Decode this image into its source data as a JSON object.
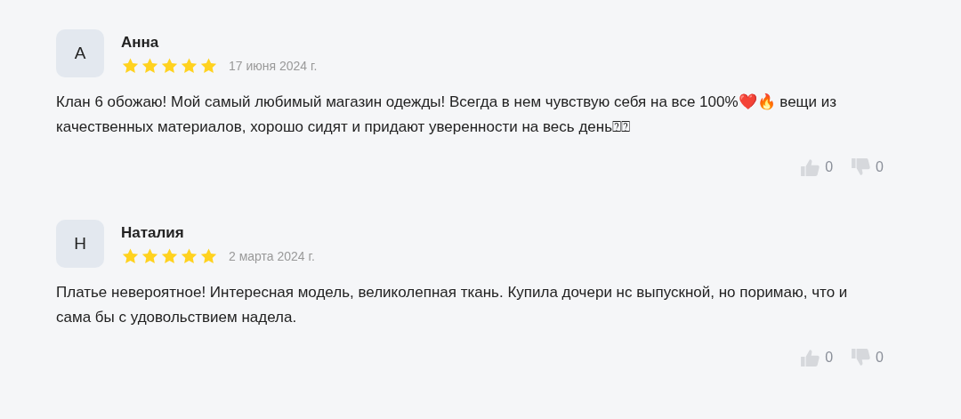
{
  "reviews": [
    {
      "initial": "А",
      "name": "Анна",
      "stars": 5,
      "date": "17 июня 2024 г.",
      "text": "Клан 6 обожаю! Мой самый любимый магазин одежды! Всегда в нем чувствую себя на все 100%❤️🔥 вещи из качественных материалов, хорошо сидят и придают уверенности на весь день⍰⍰",
      "likes": "0",
      "dislikes": "0"
    },
    {
      "initial": "Н",
      "name": "Наталия",
      "stars": 5,
      "date": "2 марта 2024 г.",
      "text": "Платье невероятное! Интересная модель, великолепная ткань. Купила дочери нс выпускной, но поримаю, что и сама бы с удовольствием надела.",
      "likes": "0",
      "dislikes": "0"
    }
  ]
}
